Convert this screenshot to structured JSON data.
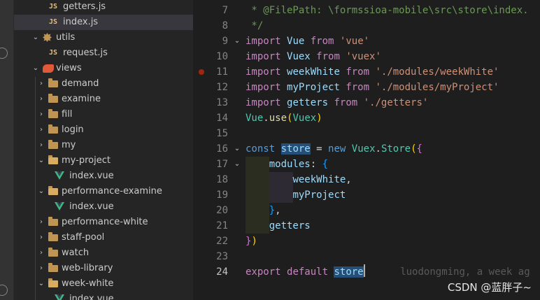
{
  "explorer": {
    "items": [
      {
        "type": "js",
        "label": "getters.js",
        "depth": 3
      },
      {
        "type": "js",
        "label": "index.js",
        "depth": 3,
        "selected": true
      },
      {
        "type": "utils",
        "label": "utils",
        "depth": 2,
        "expanded": true
      },
      {
        "type": "js",
        "label": "request.js",
        "depth": 3
      },
      {
        "type": "views",
        "label": "views",
        "depth": 2,
        "expanded": true
      },
      {
        "type": "folder",
        "label": "demand",
        "depth": 3
      },
      {
        "type": "folder",
        "label": "examine",
        "depth": 3
      },
      {
        "type": "folder",
        "label": "fill",
        "depth": 3
      },
      {
        "type": "folder",
        "label": "login",
        "depth": 3
      },
      {
        "type": "folder",
        "label": "my",
        "depth": 3
      },
      {
        "type": "folder",
        "label": "my-project",
        "depth": 3,
        "expanded": true
      },
      {
        "type": "vue",
        "label": "index.vue",
        "depth": 4
      },
      {
        "type": "folder",
        "label": "performance-examine",
        "depth": 3,
        "expanded": true
      },
      {
        "type": "vue",
        "label": "index.vue",
        "depth": 4
      },
      {
        "type": "folder",
        "label": "performance-white",
        "depth": 3
      },
      {
        "type": "folder",
        "label": "staff-pool",
        "depth": 3
      },
      {
        "type": "folder",
        "label": "watch",
        "depth": 3
      },
      {
        "type": "folder",
        "label": "web-library",
        "depth": 3
      },
      {
        "type": "folder",
        "label": "week-white",
        "depth": 3,
        "expanded": true
      },
      {
        "type": "vue",
        "label": "index.vue",
        "depth": 4
      }
    ]
  },
  "editor": {
    "lines": [
      {
        "num": "7",
        "fold": false,
        "tokens": [
          [
            "c-comment",
            " * @FilePath: \\formssioa-mobile\\src\\store\\index."
          ]
        ]
      },
      {
        "num": "8",
        "fold": false,
        "tokens": [
          [
            "c-comment",
            " */"
          ]
        ]
      },
      {
        "num": "9",
        "fold": true,
        "tokens": [
          [
            "c-kw",
            "import"
          ],
          [
            "c-plain",
            " "
          ],
          [
            "c-var",
            "Vue"
          ],
          [
            "c-plain",
            " "
          ],
          [
            "c-kw",
            "from"
          ],
          [
            "c-plain",
            " "
          ],
          [
            "c-str",
            "'vue'"
          ]
        ]
      },
      {
        "num": "10",
        "fold": false,
        "tokens": [
          [
            "c-kw",
            "import"
          ],
          [
            "c-plain",
            " "
          ],
          [
            "c-var",
            "Vuex"
          ],
          [
            "c-plain",
            " "
          ],
          [
            "c-kw",
            "from"
          ],
          [
            "c-plain",
            " "
          ],
          [
            "c-str",
            "'vuex'"
          ]
        ]
      },
      {
        "num": "11",
        "fold": false,
        "breakpoint": true,
        "tokens": [
          [
            "c-kw",
            "import"
          ],
          [
            "c-plain",
            " "
          ],
          [
            "c-var",
            "weekWhite"
          ],
          [
            "c-plain",
            " "
          ],
          [
            "c-kw",
            "from"
          ],
          [
            "c-plain",
            " "
          ],
          [
            "c-str",
            "'./modules/weekWhite'"
          ]
        ]
      },
      {
        "num": "12",
        "fold": false,
        "tokens": [
          [
            "c-kw",
            "import"
          ],
          [
            "c-plain",
            " "
          ],
          [
            "c-var",
            "myProject"
          ],
          [
            "c-plain",
            " "
          ],
          [
            "c-kw",
            "from"
          ],
          [
            "c-plain",
            " "
          ],
          [
            "c-str",
            "'./modules/myProject'"
          ]
        ]
      },
      {
        "num": "13",
        "fold": false,
        "tokens": [
          [
            "c-kw",
            "import"
          ],
          [
            "c-plain",
            " "
          ],
          [
            "c-var",
            "getters"
          ],
          [
            "c-plain",
            " "
          ],
          [
            "c-kw",
            "from"
          ],
          [
            "c-plain",
            " "
          ],
          [
            "c-str",
            "'./getters'"
          ]
        ]
      },
      {
        "num": "14",
        "fold": false,
        "tokens": [
          [
            "c-type",
            "Vue"
          ],
          [
            "c-plain",
            "."
          ],
          [
            "c-fn",
            "use"
          ],
          [
            "c-brace1",
            "("
          ],
          [
            "c-type",
            "Vuex"
          ],
          [
            "c-brace1",
            ")"
          ]
        ]
      },
      {
        "num": "15",
        "fold": false,
        "tokens": []
      },
      {
        "num": "16",
        "fold": true,
        "tokens": [
          [
            "c-blue",
            "const"
          ],
          [
            "c-plain",
            " "
          ],
          [
            "hl c-var",
            "store"
          ],
          [
            "c-plain",
            " = "
          ],
          [
            "c-blue",
            "new"
          ],
          [
            "c-plain",
            " "
          ],
          [
            "c-type",
            "Vuex"
          ],
          [
            "c-plain",
            "."
          ],
          [
            "c-type",
            "Store"
          ],
          [
            "c-brace1",
            "("
          ],
          [
            "c-brace2",
            "{"
          ]
        ]
      },
      {
        "num": "17",
        "fold": true,
        "tokens": [
          [
            "c-plain",
            "    "
          ],
          [
            "c-var",
            "modules"
          ],
          [
            "c-plain",
            ": "
          ],
          [
            "c-brace3",
            "{"
          ]
        ]
      },
      {
        "num": "18",
        "fold": false,
        "tokens": [
          [
            "c-plain",
            "        "
          ],
          [
            "c-var",
            "weekWhite"
          ],
          [
            "c-plain",
            ","
          ]
        ]
      },
      {
        "num": "19",
        "fold": false,
        "tokens": [
          [
            "c-plain",
            "        "
          ],
          [
            "c-var",
            "myProject"
          ]
        ]
      },
      {
        "num": "20",
        "fold": false,
        "tokens": [
          [
            "c-plain",
            "    "
          ],
          [
            "c-brace3",
            "}"
          ],
          [
            "c-plain",
            ","
          ]
        ]
      },
      {
        "num": "21",
        "fold": false,
        "tokens": [
          [
            "c-plain",
            "    "
          ],
          [
            "c-var",
            "getters"
          ]
        ]
      },
      {
        "num": "22",
        "fold": false,
        "tokens": [
          [
            "c-brace2",
            "}"
          ],
          [
            "c-brace1",
            ")"
          ]
        ]
      },
      {
        "num": "23",
        "fold": false,
        "tokens": []
      },
      {
        "num": "24",
        "fold": false,
        "active": true,
        "tokens": [
          [
            "c-kw",
            "export"
          ],
          [
            "c-plain",
            " "
          ],
          [
            "c-kw",
            "default"
          ],
          [
            "c-plain",
            " "
          ],
          [
            "hl c-var",
            "store"
          ],
          [
            "cursor",
            ""
          ],
          [
            "c-plain",
            "      "
          ],
          [
            "blame",
            "luodongming, a week ag"
          ]
        ]
      }
    ]
  },
  "watermark": "CSDN @蓝胖子~"
}
